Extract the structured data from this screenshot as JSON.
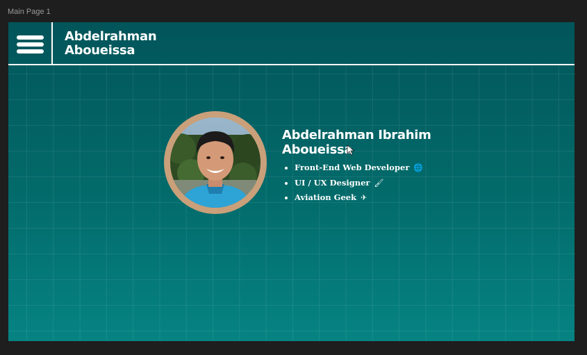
{
  "canvas": {
    "frame_label": "Main Page 1"
  },
  "header": {
    "menu_icon": "hamburger-menu-icon",
    "brand_line1": "Abdelrahman",
    "brand_line2": "Aboueissa"
  },
  "profile": {
    "photo": "profile-photo",
    "name_line1": "Abdelrahman Ibrahim",
    "name_line2": "Aboueissa",
    "roles": [
      {
        "label": "Front-End Web Developer",
        "emoji": "🌐"
      },
      {
        "label": "UI / UX Designer",
        "emoji": "🖌"
      },
      {
        "label": "Aviation Geek",
        "emoji": "✈"
      }
    ]
  },
  "colors": {
    "canvas_bg": "#1e1e1e",
    "frame_top": "#02555a",
    "frame_bottom": "#068383",
    "avatar_ring": "#c9a07a",
    "text": "#ffffff"
  }
}
